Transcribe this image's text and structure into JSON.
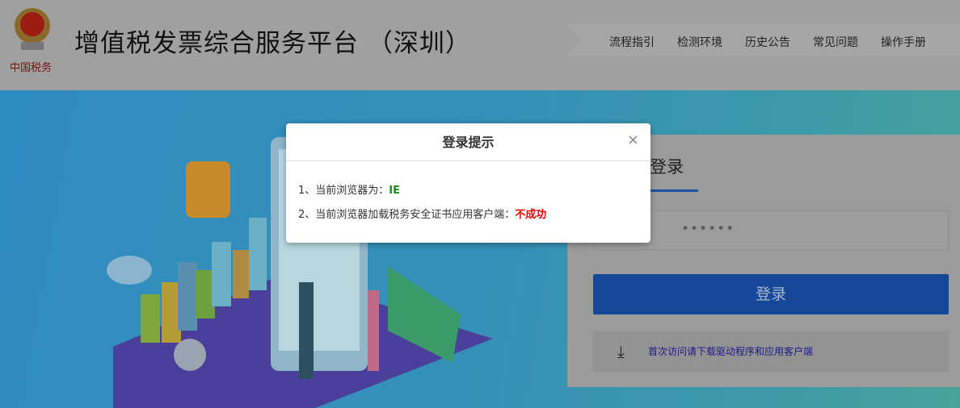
{
  "header": {
    "logo_text": "中国税务",
    "title": "增值税发票综合服务平台 （深圳）",
    "nav": [
      "流程指引",
      "检测环境",
      "历史公告",
      "常见问题",
      "操作手册"
    ]
  },
  "login": {
    "title": "登录",
    "password_mask": "••••••",
    "button": "登录",
    "download_link": "首次访问请下载驱动程序和应用客户端"
  },
  "dialog": {
    "title": "登录提示",
    "close": "×",
    "line1_label": "1、当前浏览器为：",
    "line1_value": "IE",
    "line2_label": "2、当前浏览器加载税务安全证书应用客户端：",
    "line2_value": "不成功"
  }
}
